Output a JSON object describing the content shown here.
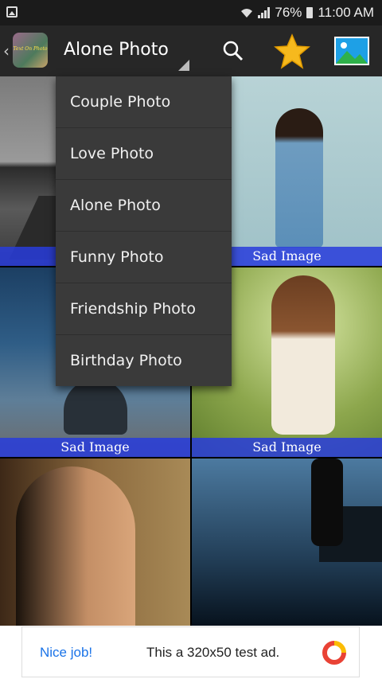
{
  "status": {
    "battery": "76%",
    "time": "11:00 AM"
  },
  "appbar": {
    "title": "Alone Photo",
    "logo_text": "Text On Photo"
  },
  "dropdown": {
    "items": [
      {
        "label": "Couple Photo"
      },
      {
        "label": "Love Photo"
      },
      {
        "label": "Alone Photo"
      },
      {
        "label": "Funny Photo"
      },
      {
        "label": "Friendship Photo"
      },
      {
        "label": "Birthday Photo"
      }
    ]
  },
  "grid": {
    "captions": [
      "Sad Image",
      "Sad Image",
      "Sad Image",
      "Sad Image"
    ]
  },
  "ad": {
    "nice": "Nice job!",
    "text": "This a 320x50 test ad."
  },
  "colors": {
    "appbar": "#272727",
    "dropdown": "#3a3a3a",
    "caption": "#2b3cdc",
    "ad_link": "#1a73e8"
  }
}
